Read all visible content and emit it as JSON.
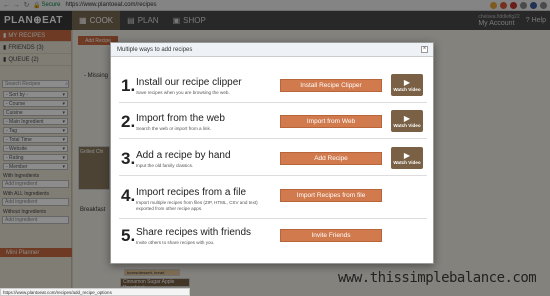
{
  "browser": {
    "secure_label": "Secure",
    "url": "https://www.plantoeat.com/recipes"
  },
  "header": {
    "logo": "PLAN⊕EAT",
    "tabs": [
      {
        "label": "COOK",
        "icon": "cook-icon"
      },
      {
        "label": "PLAN",
        "icon": "calendar-icon"
      },
      {
        "label": "SHOP",
        "icon": "cart-icon"
      }
    ],
    "account_label": "My Account",
    "help_label": "Help",
    "username": "chelsea.fiddlefig22"
  },
  "sidebar": {
    "links": [
      "MY RECIPES",
      "FRIENDS (3)",
      "QUEUE (2)"
    ],
    "search_placeholder": "Search Recipes",
    "filters": [
      "- Sort by -",
      "- Course",
      "Cuisine",
      "- Main Ingredient",
      "- Tag",
      "- Total Time",
      "- Website",
      "- Rating",
      "- Member"
    ],
    "with_ingredients_label": "With Ingredients",
    "with_ingredients_placeholder": "Add ingredient",
    "with_all_label": "With ALL Ingredients",
    "with_all_placeholder": "Add ingredient",
    "without_label": "Without Ingredients",
    "without_placeholder": "Add ingredient",
    "mini_planner": "Mini Planner"
  },
  "background": {
    "add_recipe": "Add Recipe",
    "missing_label": "- Missing",
    "grilled_label": "Grilled Chi",
    "breakfast_label": "Breakfast",
    "bottom_card": "Cinnamon Sugar Apple Doughnut",
    "bottom_tag": "boxes/dessert, bread"
  },
  "modal": {
    "title": "Multiple ways to add recipes",
    "close": "×",
    "watch_label": "Watch Video",
    "options": [
      {
        "num": "1.",
        "title": "Install our recipe clipper",
        "desc": "Save recipes when you are browsing the web.",
        "button": "Install Recipe Clipper",
        "video": true
      },
      {
        "num": "2.",
        "title": "Import from the web",
        "desc": "Search the web or import from a link.",
        "button": "Import from Web",
        "video": true
      },
      {
        "num": "3.",
        "title": "Add a recipe by hand",
        "desc": "Input the old family classics.",
        "button": "Add Recipe",
        "video": true
      },
      {
        "num": "4.",
        "title": "Import recipes from a file",
        "desc": "Import multiple recipes from files (ZIP, HTML, CSV and text) exported from other recipe apps.",
        "button": "Import Recipes from file",
        "video": false
      },
      {
        "num": "5.",
        "title": "Share recipes with friends",
        "desc": "Invite others to share recipes with you.",
        "button": "Invite Friends",
        "video": false
      }
    ]
  },
  "status_url": "https://www.plantoeat.com/recipes/add_recipe_options",
  "watermark": "www.thissimplebalance.com",
  "colors": {
    "accent": "#d07a4e",
    "video": "#7a6145",
    "header": "#4a4a4a"
  }
}
